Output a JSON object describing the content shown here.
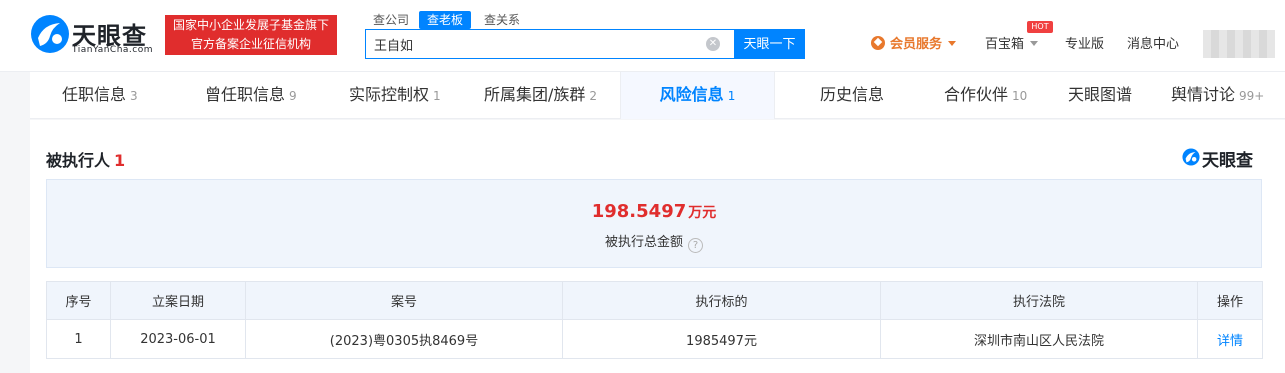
{
  "header": {
    "logo_cn": "天眼查",
    "logo_en": "TianYanCha.com",
    "slogan_line1": "国家中小企业发展子基金旗下",
    "slogan_line2": "官方备案企业征信机构",
    "search_tabs": [
      {
        "label": "查公司",
        "active": false
      },
      {
        "label": "查老板",
        "active": true
      },
      {
        "label": "查关系",
        "active": false
      }
    ],
    "search_value": "王自如",
    "search_button": "天眼一下",
    "vip_label": "会员服务",
    "baobao_label": "百宝箱",
    "hot_badge": "HOT",
    "pro_label": "专业版",
    "message_label": "消息中心"
  },
  "tabs": [
    {
      "label": "任职信息",
      "count": "3",
      "active": false
    },
    {
      "label": "曾任职信息",
      "count": "9",
      "active": false
    },
    {
      "label": "实际控制权",
      "count": "1",
      "active": false
    },
    {
      "label": "所属集团/族群",
      "count": "2",
      "active": false
    },
    {
      "label": "风险信息",
      "count": "1",
      "active": true
    },
    {
      "label": "历史信息",
      "count": "",
      "active": false
    },
    {
      "label": "合作伙伴",
      "count": "10",
      "active": false
    },
    {
      "label": "天眼图谱",
      "count": "",
      "active": false
    },
    {
      "label": "舆情讨论",
      "count": "99+",
      "active": false
    }
  ],
  "section": {
    "title": "被执行人",
    "count": "1",
    "watermark": "天眼查"
  },
  "summary": {
    "amount": "198.5497",
    "unit": "万元",
    "label": "被执行总金额",
    "help_icon": "question-icon"
  },
  "table": {
    "headers": [
      "序号",
      "立案日期",
      "案号",
      "执行标的",
      "执行法院",
      "操作"
    ],
    "rows": [
      {
        "index": "1",
        "date": "2023-06-01",
        "case_no": "(2023)粤0305执8469号",
        "amount": "1985497元",
        "court": "深圳市南山区人民法院",
        "action": "详情"
      }
    ]
  },
  "colors": {
    "brand_blue": "#0084ff",
    "alert_red": "#e02d2d",
    "vip_orange": "#e8782c"
  }
}
